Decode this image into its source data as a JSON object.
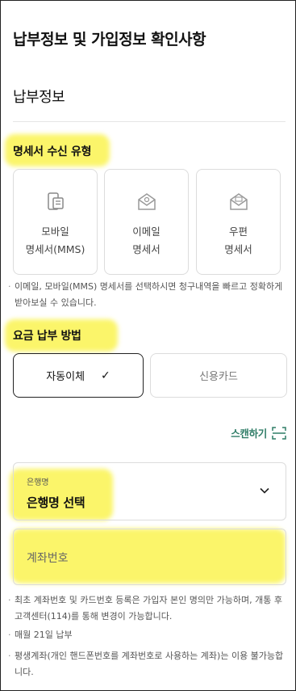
{
  "page_title": "납부정보 및 가입정보 확인사항",
  "section_title": "납부정보",
  "statement": {
    "label": "명세서 수신 유형",
    "options": [
      {
        "line1": "모바일",
        "line2": "명세서(MMS)",
        "icon": "mobile-doc-icon"
      },
      {
        "line1": "이메일",
        "line2": "명세서",
        "icon": "email-icon"
      },
      {
        "line1": "우편",
        "line2": "명세서",
        "icon": "mail-envelope-icon"
      }
    ],
    "note": "이메일, 모바일(MMS) 명세서를 선택하시면 청구내역을 빠르고 정확하게 받아보실 수 있습니다."
  },
  "payment": {
    "label": "요금 납부 방법",
    "auto_transfer": "자동이체",
    "credit_card": "신용카드",
    "selected": "자동이체",
    "check_glyph": "✓"
  },
  "scan_label": "스캔하기",
  "bank": {
    "caption": "은행명",
    "value": "은행명 선택"
  },
  "account": {
    "placeholder": "계좌번호"
  },
  "notes": [
    "최초 계좌번호 및 카드번호 등록은 가입자 본인 명의만 가능하며, 개통 후 고객센터(114)를 통해 변경이 가능합니다.",
    "매월 21일 납부",
    "평생계좌(개인 핸드폰번호를 계좌번호로 사용하는 계좌)는 이용 불가능합니다."
  ],
  "colors": {
    "highlight": "#fbf56a",
    "accent_green": "#2f7d67",
    "border": "#dcdcdc"
  }
}
